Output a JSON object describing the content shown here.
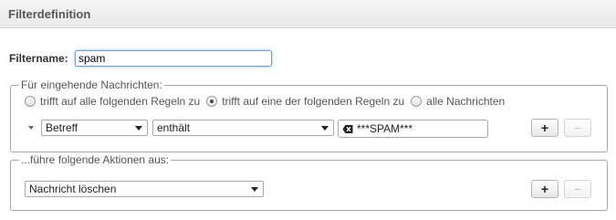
{
  "header": {
    "title": "Filterdefinition"
  },
  "filter_name": {
    "label": "Filtername:",
    "value": "spam"
  },
  "incoming": {
    "legend": "Für eingehende Nachrichten:",
    "options": [
      {
        "label": "trifft auf alle folgenden Regeln zu",
        "checked": false
      },
      {
        "label": "trifft auf eine der folgenden Regeln zu",
        "checked": true
      },
      {
        "label": "alle Nachrichten",
        "checked": false
      }
    ],
    "rule": {
      "header": "Betreff",
      "operator": "enthält",
      "value": "***SPAM***"
    },
    "add_label": "+",
    "remove_label": "−"
  },
  "actions": {
    "legend": "...führe folgende Aktionen aus:",
    "action": "Nachricht löschen",
    "add_label": "+",
    "remove_label": "−"
  }
}
